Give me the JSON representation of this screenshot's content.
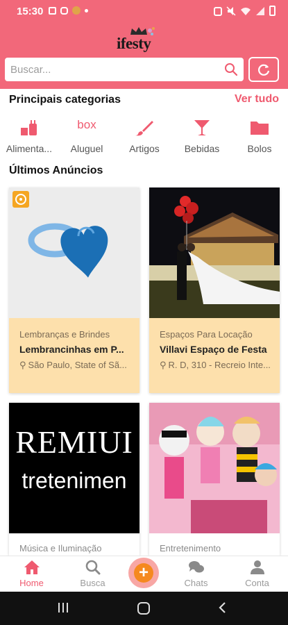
{
  "status_bar": {
    "time": "15:30"
  },
  "brand": {
    "logo_text": "ifesty"
  },
  "search": {
    "placeholder": "Buscar..."
  },
  "categories": {
    "title": "Principais categorias",
    "see_all": "Ver tudo",
    "items": [
      {
        "label": "Alimenta...",
        "icon": "food-icon"
      },
      {
        "label": "Aluguel",
        "icon": "box-icon",
        "icon_text": "box"
      },
      {
        "label": "Artigos",
        "icon": "brush-icon"
      },
      {
        "label": "Bebidas",
        "icon": "cocktail-icon"
      },
      {
        "label": "Bolos",
        "icon": "folder-icon"
      }
    ]
  },
  "listings": {
    "title": "Últimos Anúncios",
    "items": [
      {
        "category": "Lembranças e Brindes",
        "title": "Lembrancinhas em P...",
        "location": "São Paulo, State of Sã...",
        "image": "blue-heart-ring",
        "featured": true
      },
      {
        "category": "Espaços Para Locação",
        "title": "Villavi Espaço de Festa",
        "location": "R. D, 310 - Recreio Inte...",
        "image": "wedding-couple-night"
      },
      {
        "category": "Música e Iluminação",
        "image": "premium-entertainment-logo",
        "image_text_1": "REMIUI",
        "image_text_2": "tretenimen"
      },
      {
        "category": "Entretenimento",
        "image": "lol-dolls"
      }
    ]
  },
  "bottom_nav": {
    "items": [
      {
        "label": "Home",
        "icon": "home-icon",
        "active": true
      },
      {
        "label": "Busca",
        "icon": "search-icon"
      },
      {
        "label": "Chats",
        "icon": "chat-icon"
      },
      {
        "label": "Conta",
        "icon": "user-icon"
      }
    ],
    "fab_label": "+"
  },
  "colors": {
    "primary": "#f2687a",
    "accent": "#ef5a6f",
    "card_bg": "#fde0ac",
    "fab": "#f5891f"
  }
}
